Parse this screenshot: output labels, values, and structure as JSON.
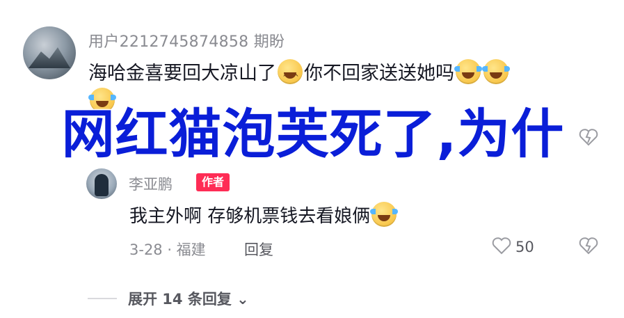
{
  "comment": {
    "username": "用户2212745874858 期盼",
    "text_part1": "海哈金喜要回大凉山了",
    "text_part2": "你不回家送送她吗"
  },
  "reply": {
    "username": "李亚鹏",
    "badge": "作者",
    "text": "我主外啊 存够机票钱去看娘俩",
    "date_location": "3-28 · 福建",
    "reply_label": "回复",
    "like_count": "50"
  },
  "expand": {
    "label": "展开 14 条回复",
    "chevron": "⌄"
  },
  "overlay": {
    "headline": "网红猫泡芙死了,为什"
  },
  "icons": {
    "avatar_main": "avatar",
    "avatar_reply": "avatar",
    "emoji_grin": "grin-emoji-icon",
    "emoji_tears": "laughing-tears-emoji-icon",
    "heart_outline": "heart-icon",
    "heart_broken": "dislike-heart-icon"
  },
  "colors": {
    "headline": "#0a1ed8",
    "badge": "#fe2c55",
    "muted": "#8a8b91"
  }
}
